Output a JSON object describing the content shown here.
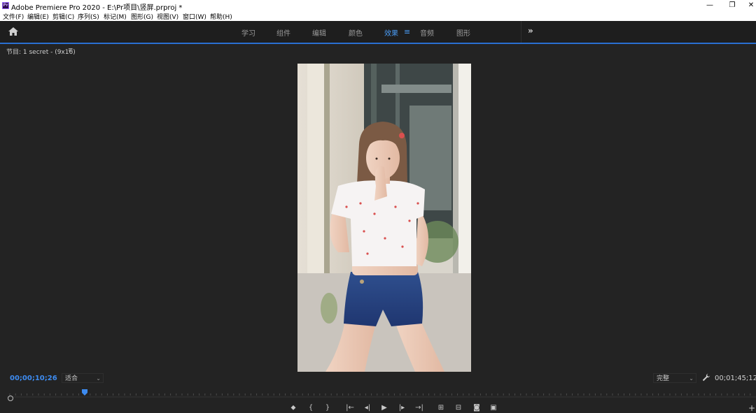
{
  "window": {
    "title": "Adobe Premiere Pro 2020 - E:\\Pr项目\\竖屏.prproj *",
    "app_icon_text": "Pr",
    "minimize": "—",
    "restore": "❐",
    "close": "✕"
  },
  "menu": [
    {
      "label": "文件(F)"
    },
    {
      "label": "编辑(E)"
    },
    {
      "label": "剪辑(C)"
    },
    {
      "label": "序列(S)"
    },
    {
      "label": "标记(M)"
    },
    {
      "label": "图形(G)"
    },
    {
      "label": "视图(V)"
    },
    {
      "label": "窗口(W)"
    },
    {
      "label": "帮助(H)"
    }
  ],
  "workspace": {
    "tabs": [
      {
        "label": "学习"
      },
      {
        "label": "组件"
      },
      {
        "label": "编辑"
      },
      {
        "label": "颜色"
      },
      {
        "label": "效果",
        "active": true
      },
      {
        "label": "音频"
      },
      {
        "label": "图形"
      }
    ],
    "menu_icon": "≡",
    "more": "»"
  },
  "program_monitor": {
    "tab_label": "节目: 1 secret - (9x16)",
    "tab_menu": "≡",
    "current_timecode": "00;00;10;26",
    "fit_select": "适合",
    "quality_select": "完整",
    "duration_timecode": "00;01;45;12"
  },
  "icons": {
    "home": "home-icon",
    "wrench": "wrench-icon",
    "playhead": "playhead-icon"
  },
  "transport": [
    {
      "name": "add-marker-button",
      "glyph": "⬥"
    },
    {
      "name": "mark-in-button",
      "glyph": "{"
    },
    {
      "name": "mark-out-button",
      "glyph": "}"
    },
    {
      "name": "go-to-in-button",
      "glyph": "|←"
    },
    {
      "name": "step-back-button",
      "glyph": "◂|"
    },
    {
      "name": "play-button",
      "glyph": "▶"
    },
    {
      "name": "step-forward-button",
      "glyph": "|▸"
    },
    {
      "name": "go-to-out-button",
      "glyph": "→|"
    },
    {
      "name": "insert-button",
      "glyph": "⊞"
    },
    {
      "name": "overwrite-button",
      "glyph": "⊟"
    },
    {
      "name": "export-frame-button",
      "glyph": "◙"
    },
    {
      "name": "compare-button",
      "glyph": "▣"
    }
  ],
  "add_button": "+",
  "colors": {
    "accent": "#4a9cf5",
    "timecode": "#3d8bf0",
    "panel_bg": "#232323",
    "workspace_bg": "#1e1e1e"
  }
}
